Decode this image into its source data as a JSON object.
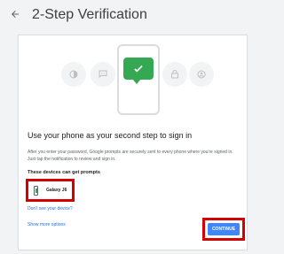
{
  "header": {
    "back_icon": "arrow-back-icon",
    "title": "2-Step Verification"
  },
  "hero": {
    "icons": [
      "brightness-icon",
      "chat-bubble-icon",
      "phone-check-icon",
      "lock-icon",
      "face-icon"
    ],
    "accent": "#34a853"
  },
  "main": {
    "heading": "Use your phone as your second step to sign in",
    "description": "After you enter your password, Google prompts are securely sent to every phone where you're signed in. Just tap the notification to review and sign in.",
    "devices_label": "These devices can get prompts",
    "devices": [
      {
        "name": "Galaxy J6",
        "icon": "phone-icon"
      }
    ],
    "dont_see_device_link": "Don't see your device?",
    "show_more_options_link": "Show more options",
    "continue_label": "CONTINUE"
  },
  "colors": {
    "primary": "#4285f4",
    "link": "#1a73e8",
    "highlight": "#d50000"
  }
}
